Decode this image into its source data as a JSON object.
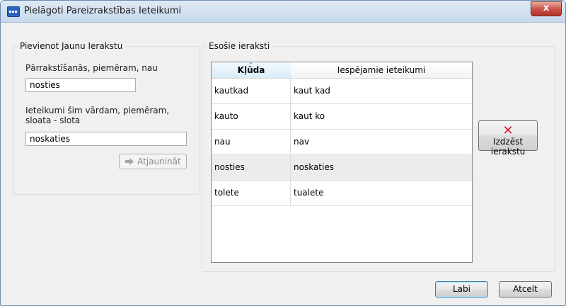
{
  "window": {
    "title": "Pielāgoti Pareizrakstības Ieteikumi",
    "close_glyph": "x"
  },
  "add_group": {
    "legend": "Pievienot Jaunu Ierakstu",
    "misspelling_label": "Pārrakstīšanās, piemēram, nau",
    "misspelling_value": "nosties",
    "suggestion_label": "Ieteikumi šim vārdam, piemēram, sloata - slota",
    "suggestion_value": "noskaties",
    "update_label": "Atjaunināt",
    "update_icon": "arrow-right-icon"
  },
  "existing_group": {
    "legend": "Esošie ieraksti",
    "columns": [
      "Kļūda",
      "Iespējamie ieteikumi"
    ],
    "rows": [
      {
        "error": "kautkad",
        "suggestion": "kaut kad"
      },
      {
        "error": "kauto",
        "suggestion": "kaut ko"
      },
      {
        "error": "nau",
        "suggestion": "nav"
      },
      {
        "error": "nosties",
        "suggestion": "noskaties"
      },
      {
        "error": "tolete",
        "suggestion": "tualete"
      }
    ],
    "selected_row": 3,
    "delete_label": "Izdzēst ierakstu",
    "delete_icon": "red-x-icon"
  },
  "footer": {
    "ok_label": "Labi",
    "cancel_label": "Atcelt"
  }
}
